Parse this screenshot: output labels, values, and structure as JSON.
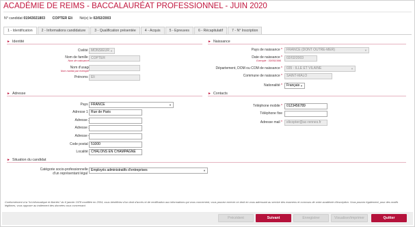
{
  "header": {
    "title_main": "ACADÉMIE DE REIMS - BACCALAURÉAT PROFESSIONNEL",
    "title_year": " - JUIN 2020",
    "candidate_label": "N° candidat",
    "candidate_number": "01943021803",
    "last_name": "COPTER",
    "first_name": "Eli",
    "birth_label": "Né(e) le",
    "birth_date": "02/02/2003"
  },
  "tabs": [
    {
      "label": "1 - Identification",
      "active": true
    },
    {
      "label": "2 - Informations candidature"
    },
    {
      "label": "3 - Qualification présentée"
    },
    {
      "label": "4 - Acquis"
    },
    {
      "label": "5 - Epreuves"
    },
    {
      "label": "6 - Récapitulatif"
    },
    {
      "label": "7 - N° Inscription"
    }
  ],
  "identite": {
    "section_title": "Identité",
    "civilite_label": "Civilité",
    "civilite_value": "MONSIEUR",
    "nom_famille_label": "Nom de famille",
    "nom_famille_hint": "Nom de naissance",
    "nom_famille_value": "COPTER",
    "nom_usage_label": "Nom d'usage",
    "nom_usage_hint": "Nom marital par exemple",
    "nom_usage_value": "",
    "prenoms_label": "Prénoms",
    "prenoms_value": "Eli"
  },
  "naissance": {
    "section_title": "Naissance",
    "pays_label": "Pays de naissance",
    "pays_value": "FRANCE (DONT OUTRE-MER)",
    "date_label": "Date de naissance",
    "date_hint": "Exemple : 30/05/1996",
    "date_value": "02/02/2003",
    "departement_label": "Département, DOM ou COM de naissance",
    "departement_value": "035 - ILLE ET VILAINE",
    "commune_label": "Commune de naissance",
    "commune_value": "SAINT-MALO",
    "nationalite_label": "Nationalité",
    "nationalite_value": "Français"
  },
  "adresse": {
    "section_title": "Adresse",
    "pays_label": "Pays",
    "pays_value": "FRANCE",
    "adresse1_label": "Adresse 1",
    "adresse1_value": "Rue de Paris",
    "adresse2_label": "Adresse 2",
    "adresse2_value": "",
    "adresse3_label": "Adresse 3",
    "adresse3_value": "",
    "adresse4_label": "Adresse 4",
    "adresse4_value": "",
    "cp_label": "Code postal",
    "cp_value": "51000",
    "localite_label": "Localité",
    "localite_value": "CHALONS EN CHAMPAGNE"
  },
  "contacts": {
    "section_title": "Contacts",
    "mobile_label": "Téléphone mobile",
    "mobile_value": "0123456789",
    "fixe_label": "Téléphone fixe",
    "fixe_value": "",
    "mail_label": "Adresse mail",
    "mail_value": "elicopter@ac-rennes.fr"
  },
  "situation": {
    "section_title": "Situation du candidat",
    "categorie_label_1": "Catégorie socio-professionnelle",
    "categorie_label_2": "d'un représentant légal",
    "categorie_value": "Employés administratifs d'entreprises"
  },
  "legal_text": "Conformément à la \"loi informatique et libertés\" du 6 janvier 1978 modifiée en 2004, vous bénéficiez d'un droit d'accès et de rectification aux informations qui vous concernent, vous pouvez exercer ce droit en vous adressant au service des examens et concours de votre académie d'inscription. Vous pouvez également, pour des motifs légitimes, vous opposer au traitement des données vous concernant.",
  "buttons": {
    "precedent": "Précédent",
    "suivant": "Suivant",
    "enregistrer": "Enregistrer",
    "visualiser": "Visualiser/imprimer",
    "quitter": "Quitter"
  },
  "colors": {
    "accent": "#c0143c",
    "button_primary": "#b5123b"
  }
}
